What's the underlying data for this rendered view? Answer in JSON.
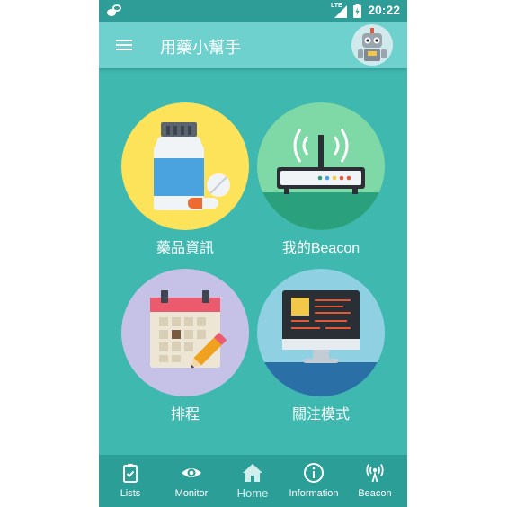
{
  "status_bar": {
    "time": "20:22",
    "network_label": "LTE"
  },
  "app_bar": {
    "title": "用藥小幫手"
  },
  "tiles": [
    {
      "label": "藥品資訊",
      "icon": "pill-bottle-icon",
      "color": "#fde35a"
    },
    {
      "label": "我的Beacon",
      "icon": "beacon-router-icon",
      "color": "#7ed9a6"
    },
    {
      "label": "排程",
      "icon": "calendar-pencil-icon",
      "color": "#c6c1e6"
    },
    {
      "label": "關注模式",
      "icon": "monitor-icon",
      "color": "#8fd0e3"
    }
  ],
  "bottom_nav": [
    {
      "label": "Lists",
      "icon": "clipboard-icon"
    },
    {
      "label": "Monitor",
      "icon": "eye-icon"
    },
    {
      "label": "Home",
      "icon": "home-icon",
      "active": true
    },
    {
      "label": "Information",
      "icon": "info-icon"
    },
    {
      "label": "Beacon",
      "icon": "beacon-icon"
    }
  ],
  "colors": {
    "background": "#3fb8b0",
    "app_bar": "#6fd1cd",
    "status_bar": "#2e9d97",
    "bottom_nav": "#2c9e98"
  }
}
